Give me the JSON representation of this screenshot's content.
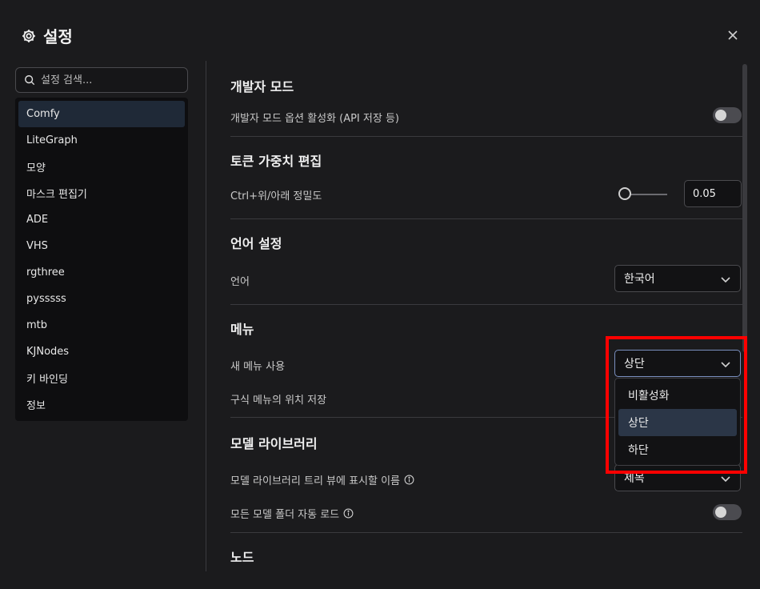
{
  "header": {
    "title": "설정"
  },
  "search": {
    "placeholder": "설정 검색..."
  },
  "sidebar": {
    "items": [
      {
        "label": "Comfy",
        "active": true
      },
      {
        "label": "LiteGraph"
      },
      {
        "label": "모양"
      },
      {
        "label": "마스크 편집기"
      },
      {
        "label": "ADE"
      },
      {
        "label": "VHS"
      },
      {
        "label": "rgthree"
      },
      {
        "label": "pysssss"
      },
      {
        "label": "mtb"
      },
      {
        "label": "KJNodes"
      },
      {
        "label": "키 바인딩"
      },
      {
        "label": "정보"
      }
    ]
  },
  "sections": {
    "dev": {
      "title": "개발자 모드",
      "option_label": "개발자 모드 옵션 활성화 (API 저장 등)",
      "toggle_on": false
    },
    "token": {
      "title": "토큰 가중치 편집",
      "precision_label": "Ctrl+위/아래 정밀도",
      "precision_value": "0.05",
      "slider_fraction": 0.0
    },
    "language": {
      "title": "언어 설정",
      "label": "언어",
      "value": "한국어"
    },
    "menu": {
      "title": "메뉴",
      "new_menu_label": "새 메뉴 사용",
      "new_menu_value": "상단",
      "save_position_label": "구식 메뉴의 위치 저장",
      "options": [
        "비활성화",
        "상단",
        "하단"
      ],
      "selected_option": "상단"
    },
    "model_library": {
      "title": "모델 라이브러리",
      "name_label": "모델 라이브러리 트리 뷰에 표시할 이름",
      "name_value": "제목",
      "autoload_label": "모든 모델 폴더 자동 로드",
      "autoload_on": false
    },
    "node": {
      "title": "노드"
    }
  },
  "colors": {
    "background": "#1b1b1d",
    "highlight": "#ff0000",
    "active_item": "#1f2937",
    "selected_option": "#2b3647"
  },
  "icons": {
    "header": "gear-icon",
    "close": "close-icon",
    "search": "search-icon",
    "chevron": "chevron-down-icon",
    "info": "info-icon"
  }
}
